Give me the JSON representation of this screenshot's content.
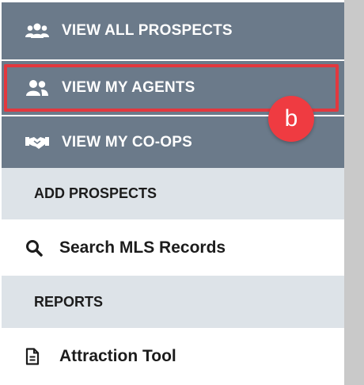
{
  "nav": {
    "items": [
      {
        "label": "VIEW ALL PROSPECTS",
        "icon": "users-group-icon"
      },
      {
        "label": "VIEW MY AGENTS",
        "icon": "users-icon"
      },
      {
        "label": "VIEW MY CO-OPS",
        "icon": "handshake-icon"
      }
    ]
  },
  "sections": [
    {
      "title": "ADD PROSPECTS",
      "items": [
        {
          "label": "Search MLS Records",
          "icon": "search-icon"
        }
      ]
    },
    {
      "title": "REPORTS",
      "items": [
        {
          "label": "Attraction Tool",
          "icon": "document-icon"
        }
      ]
    }
  ],
  "annotation": {
    "label": "b",
    "color": "#ef3b41"
  },
  "colors": {
    "nav_bg": "#6b7a8a",
    "section_bg": "#dde3e8",
    "highlight": "#e2383e"
  }
}
